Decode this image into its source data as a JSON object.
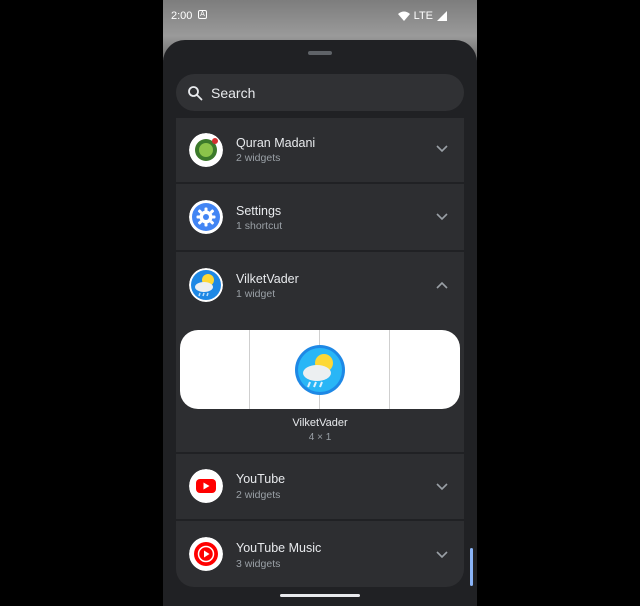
{
  "status_bar": {
    "time": "2:00",
    "network": "LTE"
  },
  "search": {
    "placeholder": "Search"
  },
  "apps": [
    {
      "name": "Quran Madani",
      "subtitle": "2 widgets",
      "icon": "quran-madani-icon",
      "expanded": false
    },
    {
      "name": "Settings",
      "subtitle": "1 shortcut",
      "icon": "settings-gear-icon",
      "expanded": false
    },
    {
      "name": "VilketVader",
      "subtitle": "1 widget",
      "icon": "weather-cloud-sun-icon",
      "expanded": true
    },
    {
      "name": "YouTube",
      "subtitle": "2 widgets",
      "icon": "youtube-icon",
      "expanded": false
    },
    {
      "name": "YouTube Music",
      "subtitle": "3 widgets",
      "icon": "youtube-music-icon",
      "expanded": false
    }
  ],
  "widget_preview": {
    "name": "VilketVader",
    "size": "4 × 1"
  },
  "colors": {
    "sheet": "#202124",
    "card": "#2d2e31",
    "accent": "#8ab4f8",
    "youtube_red": "#ff0000",
    "settings_blue": "#4285f4"
  }
}
